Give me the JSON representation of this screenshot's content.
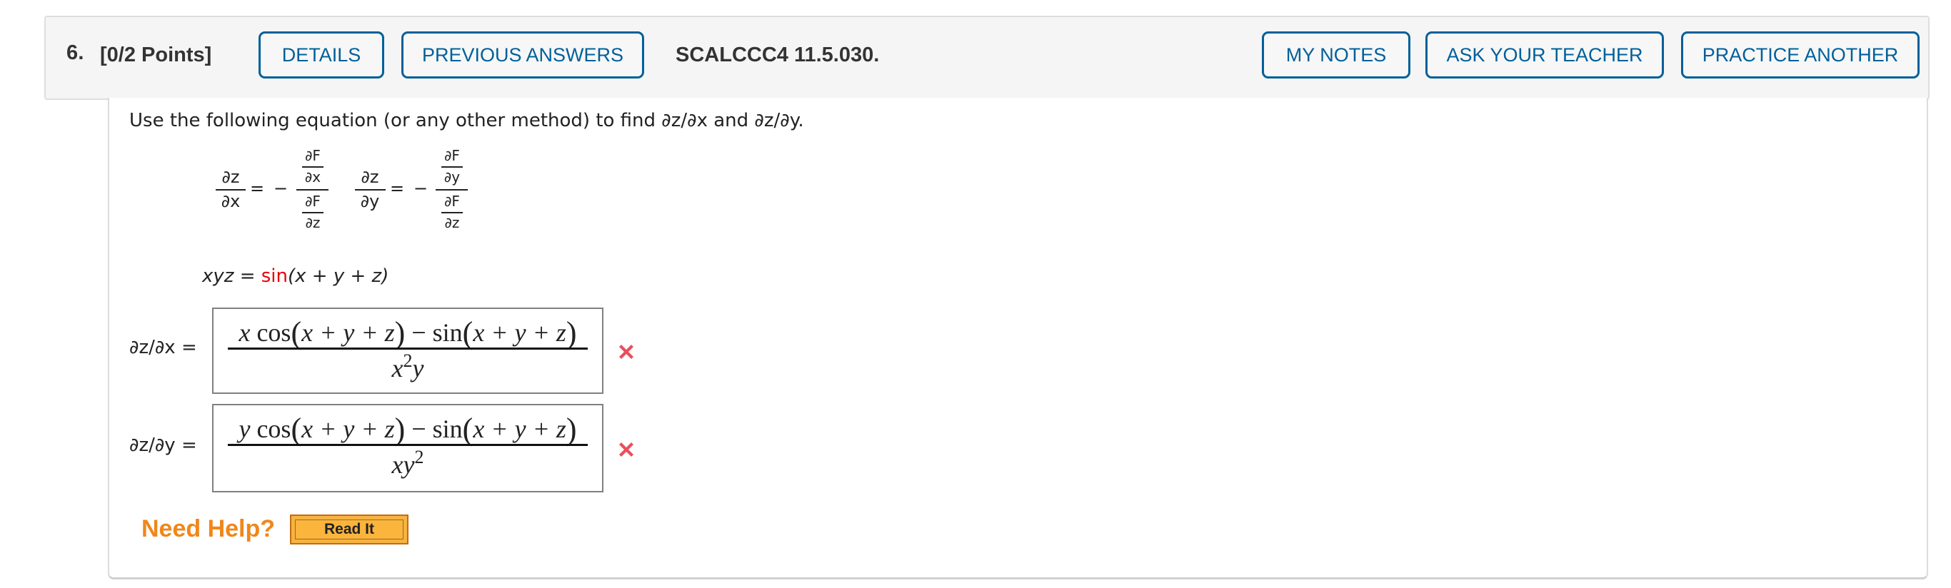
{
  "header": {
    "question_number": "6.",
    "points": "[0/2 Points]",
    "buttons_left": [
      "DETAILS",
      "PREVIOUS ANSWERS"
    ],
    "question_id": "SCALCCC4 11.5.030.",
    "buttons_right": [
      "MY NOTES",
      "ASK YOUR TEACHER",
      "PRACTICE ANOTHER"
    ]
  },
  "question": {
    "instruction": "Use the following equation (or any other method) to find ∂z/∂x and ∂z/∂y.",
    "formula": {
      "dz": "∂z",
      "dx": "∂x",
      "dy": "∂y",
      "dF": "∂F",
      "eq": "=",
      "minus": "−"
    },
    "equation": {
      "lhs": "xyz",
      "equals": "=",
      "func": "sin",
      "args": "(x + y + z)"
    }
  },
  "answers": [
    {
      "label": "∂z/∂x =",
      "numerator_coef": "x",
      "numerator_mid": "cos",
      "numerator_arg": "x + y + z",
      "numerator_minus": "− sin",
      "denominator_base": "x",
      "denominator_exp": "2",
      "denominator_tail": "y",
      "status": "incorrect",
      "status_icon": "red-x-icon"
    },
    {
      "label": "∂z/∂y =",
      "numerator_coef": "y",
      "numerator_mid": "cos",
      "numerator_arg": "x + y + z",
      "numerator_minus": "− sin",
      "denominator_base": "xy",
      "denominator_exp": "2",
      "denominator_tail": "",
      "status": "incorrect",
      "status_icon": "red-x-icon"
    }
  ],
  "help": {
    "label": "Need Help?",
    "read_it": "Read It"
  },
  "colors": {
    "button_accent": "#00609a",
    "error_red": "#e8505b",
    "function_red": "#e8000b",
    "help_orange": "#f0871a",
    "read_it_bg": "#f6b341"
  }
}
